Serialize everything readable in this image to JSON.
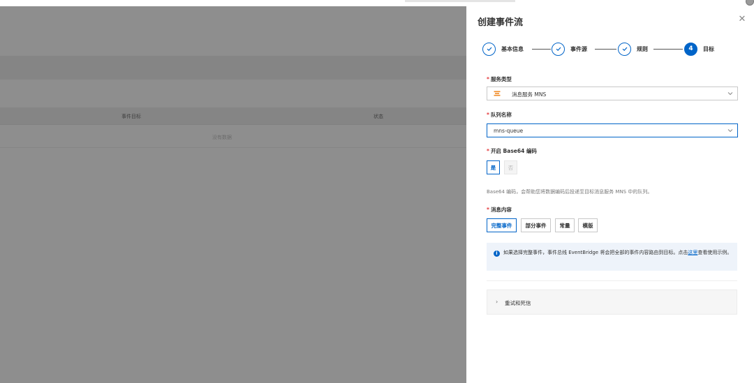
{
  "background": {
    "table_headers": [
      "事件目标",
      "状态"
    ],
    "empty_text": "没有数据"
  },
  "drawer": {
    "title": "创建事件流",
    "close_icon": "close-icon",
    "steps": [
      {
        "label": "基本信息",
        "state": "done"
      },
      {
        "label": "事件源",
        "state": "done"
      },
      {
        "label": "规则",
        "state": "done"
      },
      {
        "label": "目标",
        "state": "active",
        "number": "4"
      }
    ],
    "service_type": {
      "label": "服务类型",
      "value": "消息服务 MNS"
    },
    "queue_name": {
      "label": "队列名称",
      "value": "mns-queue"
    },
    "base64": {
      "label": "开启 Base64 编码",
      "options": [
        "是",
        "否"
      ],
      "selected": "是"
    },
    "base64_hint": "Base64 编码，会帮助您将数据编码后投递至目标消息服务 MNS 中的队列。",
    "message_content": {
      "label": "消息内容",
      "options": [
        "完整事件",
        "部分事件",
        "常量",
        "模版"
      ],
      "selected": "完整事件"
    },
    "info": {
      "text_before": "如果选择完整事件，事件总线 EventBridge 将会把全部的事件内容路由到目标。点击",
      "link": "这里",
      "text_after": "查看使用示例。"
    },
    "retry": {
      "label": "重试和死信"
    }
  },
  "colors": {
    "primary": "#0064c8",
    "required": "#e4393c",
    "mask": "#8e8e8e",
    "info_bg": "#eef3fa"
  }
}
